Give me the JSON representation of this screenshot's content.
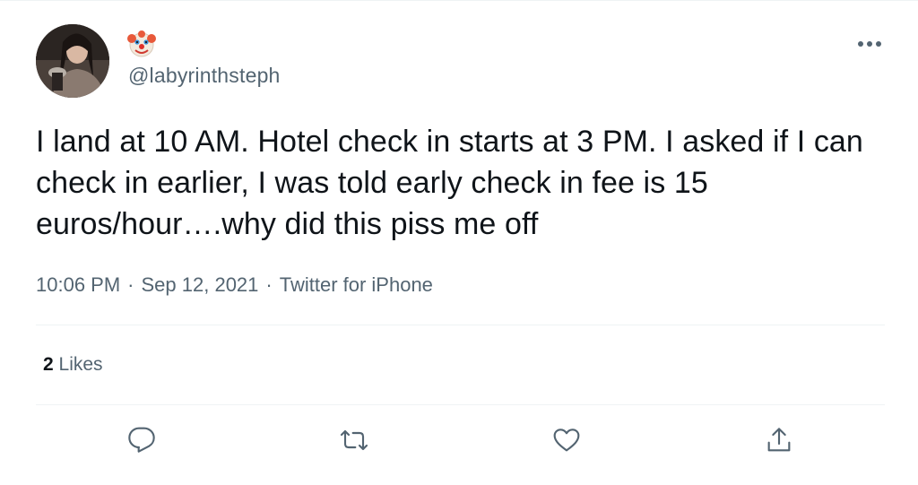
{
  "author": {
    "name_emoji": "🤡",
    "handle": "@labyrinthsteph",
    "avatar": "avatar-photo"
  },
  "tweet": {
    "text": "I land at 10 AM. Hotel check in starts at 3 PM. I asked if I can check in earlier, I was told early check in fee is 15 euros/hour….why did this piss me off",
    "time": "10:06 PM",
    "separator": "·",
    "date": "Sep 12, 2021",
    "source": "Twitter for iPhone"
  },
  "stats": {
    "likes_count": "2",
    "likes_label": "Likes"
  },
  "actions": [
    {
      "name": "reply",
      "icon": "reply-icon"
    },
    {
      "name": "retweet",
      "icon": "retweet-icon"
    },
    {
      "name": "like",
      "icon": "heart-icon"
    },
    {
      "name": "share",
      "icon": "share-icon"
    }
  ],
  "more_icon": "more-icon",
  "colors": {
    "text": "#0f1419",
    "secondary": "#536471",
    "divider": "#eff3f4"
  }
}
